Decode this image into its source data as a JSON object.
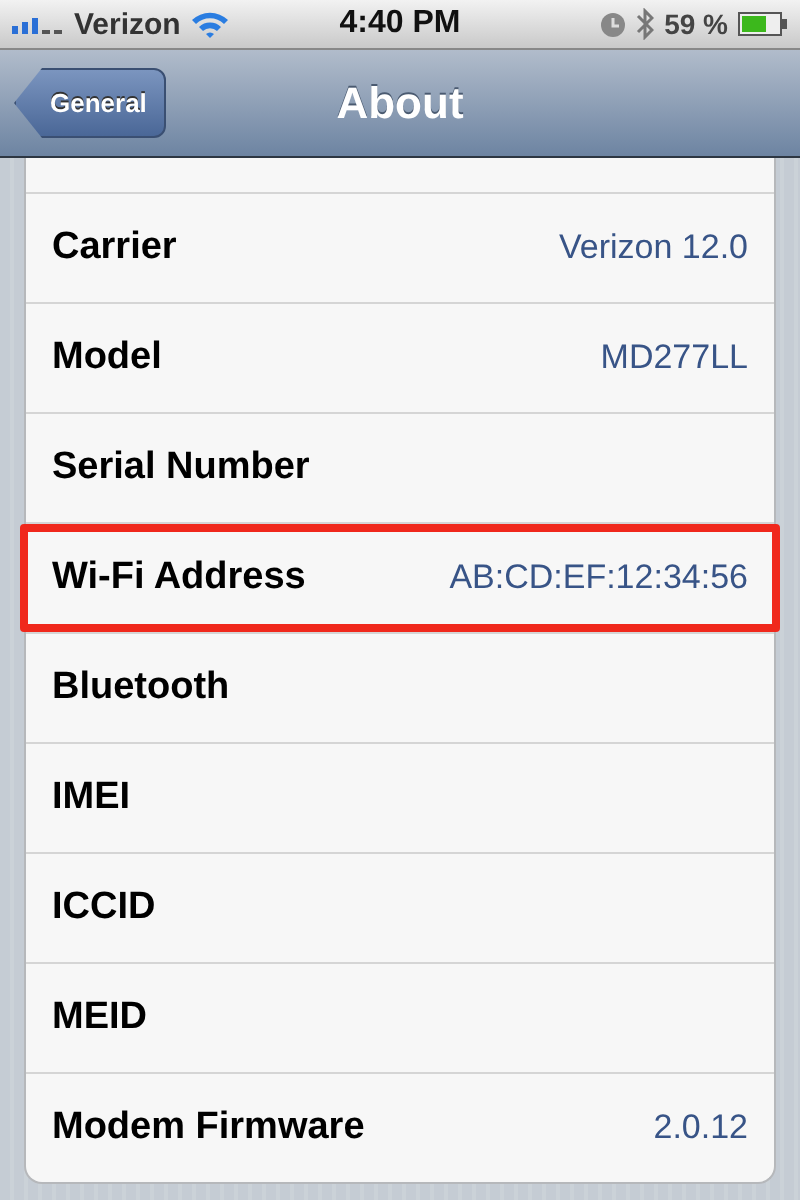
{
  "status_bar": {
    "carrier": "Verizon",
    "time": "4:40 PM",
    "battery": "59 %"
  },
  "nav_bar": {
    "back": "General",
    "title": "About"
  },
  "rows": [
    {
      "label": "Carrier",
      "value": "Verizon 12.0",
      "highlighted": false
    },
    {
      "label": "Model",
      "value": "MD277LL",
      "highlighted": false
    },
    {
      "label": "Serial Number",
      "highlighted": false
    },
    {
      "label": "Wi-Fi Address",
      "value": "AB:CD:EF:12:34:56",
      "highlighted": true
    },
    {
      "label": "Bluetooth",
      "highlighted": false
    },
    {
      "label": "IMEI",
      "highlighted": false
    },
    {
      "label": "ICCID",
      "highlighted": false
    },
    {
      "label": "MEID",
      "highlighted": false
    },
    {
      "label": "Modem Firmware",
      "value": "2.0.12",
      "highlighted": false
    }
  ]
}
